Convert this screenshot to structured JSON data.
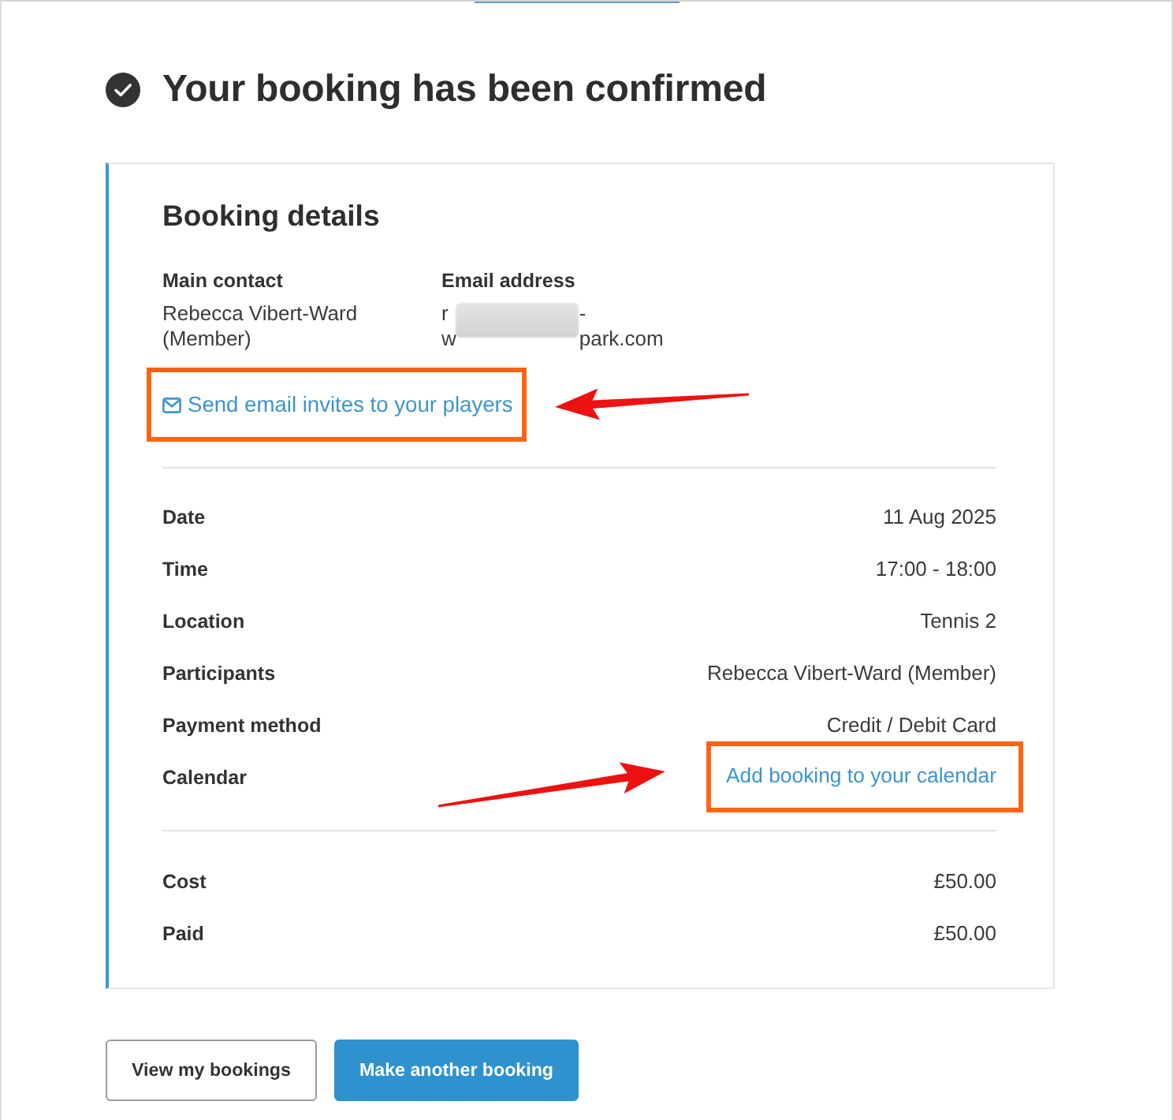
{
  "page": {
    "title": "Your booking has been confirmed"
  },
  "booking_details": {
    "title": "Booking details",
    "contact": {
      "label": "Main contact",
      "lines": [
        "Rebecca Vibert-Ward",
        "(Member)"
      ]
    },
    "email": {
      "label": "Email address",
      "lines": [
        {
          "start": "r",
          "end": "-"
        },
        {
          "start": "w",
          "end": "park.com"
        }
      ],
      "redacted": true
    },
    "invite_link": {
      "text": "Send email invites to your players",
      "highlighted": true
    },
    "details": [
      {
        "label": "Date",
        "value": "11 Aug 2025",
        "kind": "text",
        "highlighted": false
      },
      {
        "label": "Time",
        "value": "17:00 - 18:00",
        "kind": "text",
        "highlighted": false
      },
      {
        "label": "Location",
        "value": "Tennis 2",
        "kind": "text",
        "highlighted": false
      },
      {
        "label": "Participants",
        "value": "Rebecca Vibert-Ward (Member)",
        "kind": "text",
        "highlighted": false
      },
      {
        "label": "Payment method",
        "value": "Credit / Debit Card",
        "kind": "text",
        "highlighted": false
      },
      {
        "label": "Calendar",
        "value": "Add booking to your calendar",
        "kind": "link",
        "highlighted": true
      }
    ],
    "payment": [
      {
        "label": "Cost",
        "value": "£50.00"
      },
      {
        "label": "Paid",
        "value": "£50.00"
      }
    ]
  },
  "buttons": [
    {
      "label": "View my bookings",
      "kind": "secondary"
    },
    {
      "label": "Make another booking",
      "kind": "primary"
    }
  ]
}
